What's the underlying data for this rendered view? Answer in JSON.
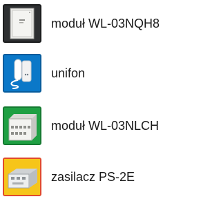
{
  "items": [
    {
      "label": "moduł WL-03NQH8",
      "icon": "wall-module-cabinet-icon",
      "tile_color": "#2d2f31"
    },
    {
      "label": "unifon",
      "icon": "intercom-handset-icon",
      "tile_color": "#0b78c8"
    },
    {
      "label": "moduł WL-03NLCH",
      "icon": "terminal-module-box-icon",
      "tile_color": "#1fa043"
    },
    {
      "label": "zasilacz PS-2E",
      "icon": "din-rail-power-supply-icon",
      "tile_color": "#f6c51a"
    }
  ]
}
